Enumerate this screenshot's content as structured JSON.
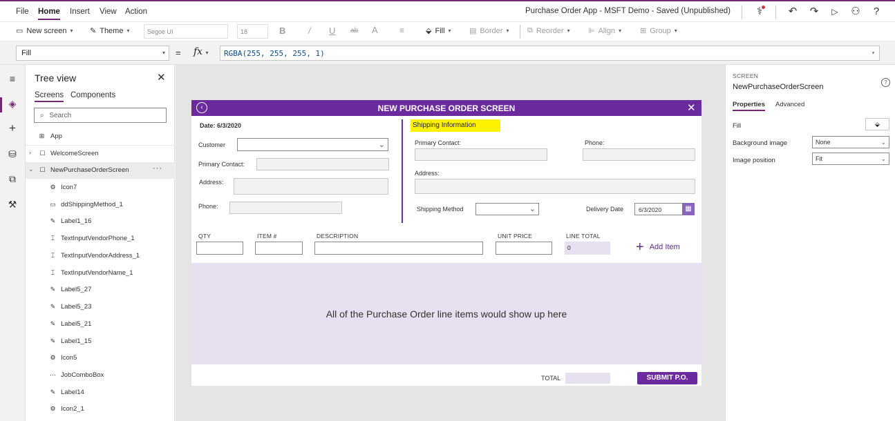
{
  "menubar": {
    "items": [
      "File",
      "Home",
      "Insert",
      "View",
      "Action"
    ],
    "active": "Home",
    "app_title": "Purchase Order App - MSFT Demo - Saved (Unpublished)"
  },
  "toolbar": {
    "new_screen": "New screen",
    "theme": "Theme",
    "font_family": "Segoe UI",
    "font_size": "18",
    "fill": "Fill",
    "border": "Border",
    "reorder": "Reorder",
    "align": "Align",
    "group": "Group"
  },
  "formula_bar": {
    "property": "Fill",
    "equals": "=",
    "fx": "fx",
    "formula": "RGBA(255, 255, 255, 1)"
  },
  "tree": {
    "title": "Tree view",
    "tabs": [
      "Screens",
      "Components"
    ],
    "search_placeholder": "Search",
    "items": [
      {
        "label": "App",
        "icon": "app-icon"
      },
      {
        "label": "WelcomeScreen",
        "icon": "screen-icon"
      },
      {
        "label": "NewPurchaseOrderScreen",
        "icon": "screen-icon",
        "more": "···"
      },
      {
        "label": "Icon7",
        "icon": "icon-control-icon"
      },
      {
        "label": "ddShippingMethod_1",
        "icon": "dropdown-icon"
      },
      {
        "label": "Label1_16",
        "icon": "label-icon"
      },
      {
        "label": "TextInputVendorPhone_1",
        "icon": "textinput-icon"
      },
      {
        "label": "TextInputVendorAddress_1",
        "icon": "textinput-icon"
      },
      {
        "label": "TextInputVendorName_1",
        "icon": "textinput-icon"
      },
      {
        "label": "Label5_27",
        "icon": "label-icon"
      },
      {
        "label": "Label5_23",
        "icon": "label-icon"
      },
      {
        "label": "Label5_21",
        "icon": "label-icon"
      },
      {
        "label": "Label1_15",
        "icon": "label-icon"
      },
      {
        "label": "Icon5",
        "icon": "icon-control-icon"
      },
      {
        "label": "JobComboBox",
        "icon": "combobox-icon"
      },
      {
        "label": "Label14",
        "icon": "label-icon"
      },
      {
        "label": "Icon2_1",
        "icon": "icon-control-icon"
      }
    ]
  },
  "screen": {
    "title": "NEW PURCHASE ORDER SCREEN",
    "date_label": "Date: 6/3/2020",
    "customer_label": "Customer",
    "primary_contact_label": "Primary Contact:",
    "address_label": "Address:",
    "phone_label": "Phone:",
    "shipping_info": "Shipping Information",
    "ship_primary_contact_label": "Primary Contact:",
    "ship_phone_label": "Phone:",
    "ship_address_label": "Address:",
    "shipping_method_label": "Shipping Method",
    "delivery_date_label": "Delivery Date",
    "delivery_date_value": "6/3/2020",
    "columns": [
      "QTY",
      "ITEM #",
      "DESCRIPTION",
      "UNIT PRICE",
      "LINE TOTAL"
    ],
    "line_total_value": "0",
    "add_item": "Add Item",
    "items_message": "All of the Purchase Order line items would show up here",
    "total_label": "TOTAL",
    "submit": "SUBMIT P.O."
  },
  "props": {
    "kind": "SCREEN",
    "name": "NewPurchaseOrderScreen",
    "tabs": [
      "Properties",
      "Advanced"
    ],
    "fill_label": "Fill",
    "bg_image_label": "Background image",
    "bg_image_value": "None",
    "image_position_label": "Image position",
    "image_position_value": "Fit"
  },
  "colors": {
    "accent": "#742774",
    "screen_header": "#6b2a9e",
    "items_bg": "#e6e0f0",
    "highlight": "#fff200"
  }
}
